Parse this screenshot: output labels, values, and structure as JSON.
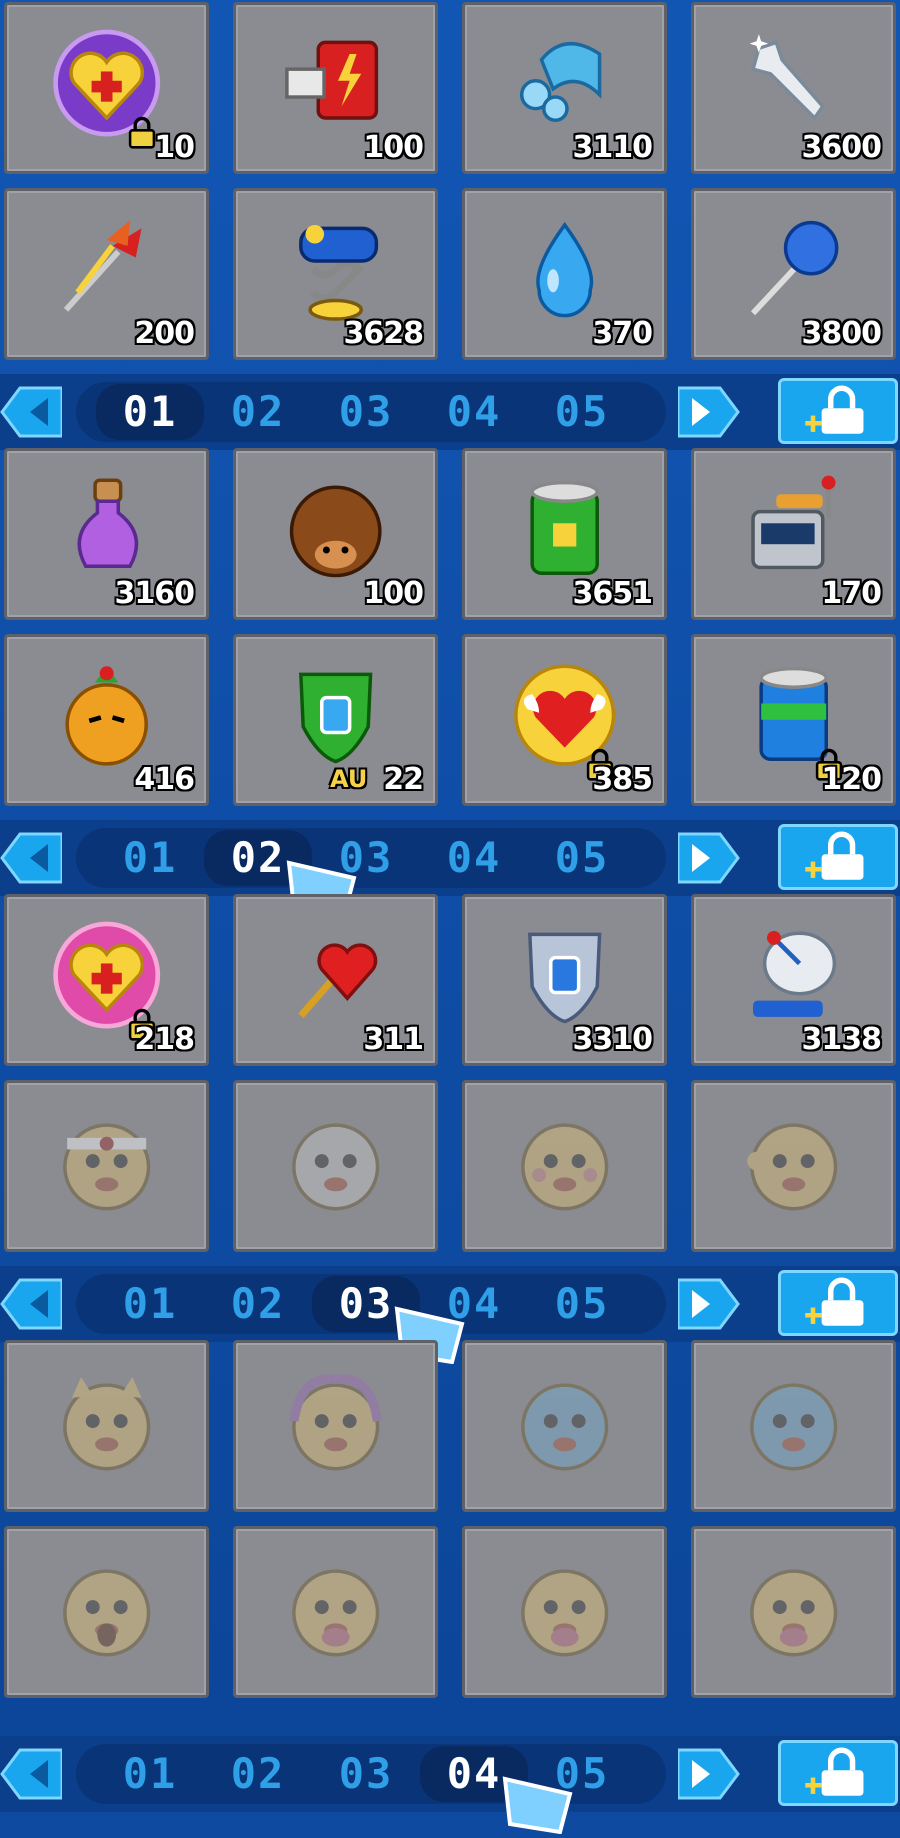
{
  "inventory": {
    "sections": [
      {
        "slots": [
          {
            "icon": "heart-medal-purple-icon",
            "qty": "10",
            "badge": "lock"
          },
          {
            "icon": "battery-charger-icon",
            "qty": "100"
          },
          {
            "icon": "goggles-icon",
            "qty": "3110"
          },
          {
            "icon": "wrench-icon",
            "qty": "3600"
          },
          {
            "icon": "darts-icon",
            "qty": "200"
          },
          {
            "icon": "spring-boxing-glove-icon",
            "qty": "3628"
          },
          {
            "icon": "water-drop-icon",
            "qty": "370"
          },
          {
            "icon": "feather-duster-icon",
            "qty": "3800"
          }
        ],
        "pager": {
          "pages": [
            "01",
            "02",
            "03",
            "04",
            "05"
          ],
          "active": 0
        }
      },
      {
        "slots": [
          {
            "icon": "purple-potion-icon",
            "qty": "3160"
          },
          {
            "icon": "hedgehog-icon",
            "qty": "100"
          },
          {
            "icon": "green-can-icon",
            "qty": "3651"
          },
          {
            "icon": "slot-machine-icon",
            "qty": "170"
          },
          {
            "icon": "pineapple-creature-icon",
            "qty": "416"
          },
          {
            "icon": "green-shield-icon",
            "qty": "22",
            "tag": "AU"
          },
          {
            "icon": "winged-heart-icon",
            "qty": "385",
            "badge": "lock"
          },
          {
            "icon": "blue-can-icon",
            "qty": "120",
            "badge": "lock"
          }
        ],
        "pager": {
          "pages": [
            "01",
            "02",
            "03",
            "04",
            "05"
          ],
          "active": 1
        }
      },
      {
        "slots": [
          {
            "icon": "heart-medal-pink-icon",
            "qty": "218",
            "badge": "lock"
          },
          {
            "icon": "heart-wand-icon",
            "qty": "311"
          },
          {
            "icon": "silver-shield-icon",
            "qty": "3310"
          },
          {
            "icon": "satellite-dish-icon",
            "qty": "3138"
          },
          {
            "icon": "headband-emoticon-icon",
            "qty": "",
            "faded": true
          },
          {
            "icon": "grey-ghost-emoticon-icon",
            "qty": "",
            "faded": true
          },
          {
            "icon": "blush-emoticon-icon",
            "qty": "",
            "faded": true
          },
          {
            "icon": "wink-emoticon-icon",
            "qty": "",
            "faded": true
          }
        ],
        "pager": {
          "pages": [
            "01",
            "02",
            "03",
            "04",
            "05"
          ],
          "active": 2
        }
      },
      {
        "slots": [
          {
            "icon": "cat-emoticon-icon",
            "qty": "",
            "faded": true
          },
          {
            "icon": "flame-emoticon-icon",
            "qty": "",
            "faded": true
          },
          {
            "icon": "blue-bird-emoticon-icon",
            "qty": "",
            "faded": true
          },
          {
            "icon": "blue-bird-emoticon-icon",
            "qty": "",
            "faded": true
          },
          {
            "icon": "scared-emoticon-icon",
            "qty": "",
            "faded": true
          },
          {
            "icon": "tongue-emoticon-icon",
            "qty": "",
            "faded": true
          },
          {
            "icon": "tongue-emoticon-icon",
            "qty": "",
            "faded": true
          },
          {
            "icon": "tongue-emoticon-icon",
            "qty": "",
            "faded": true
          }
        ],
        "pager": {
          "pages": [
            "01",
            "02",
            "03",
            "04",
            "05"
          ],
          "active": 3
        }
      }
    ]
  },
  "colors": {
    "background": "#1256b4",
    "slot": "#8a8c92",
    "page_inactive": "#2fa0e8",
    "page_active": "#ffffff",
    "unlock_button": "#1aa6ee"
  }
}
